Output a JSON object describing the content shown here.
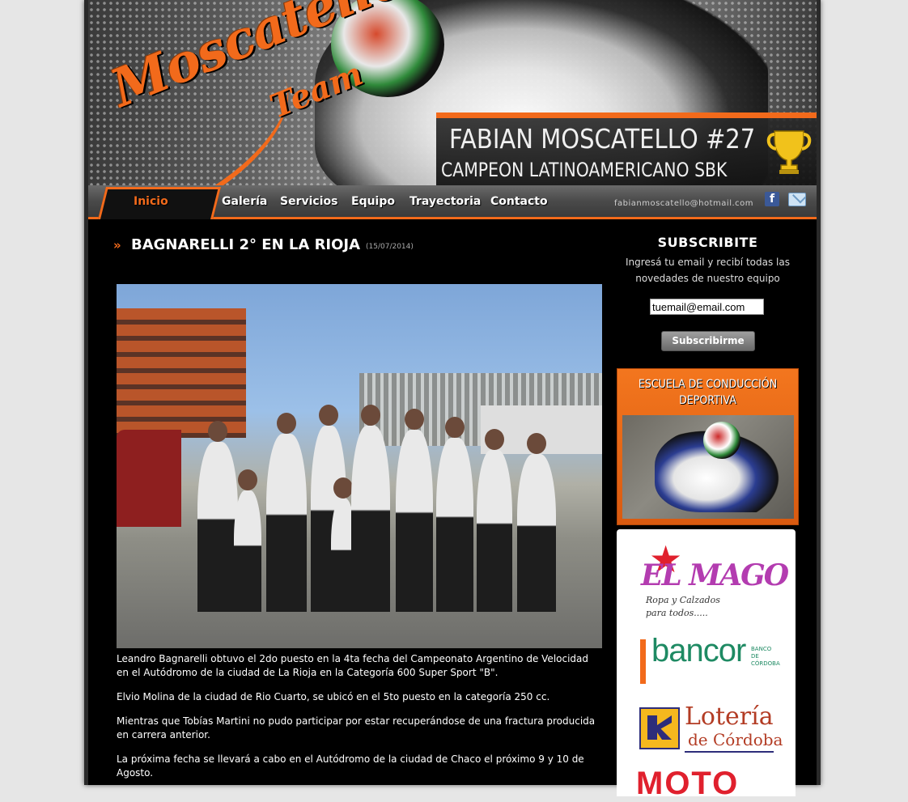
{
  "header": {
    "logo_main": "Moscatello",
    "logo_sub": "Team",
    "champion_name": "FABIAN MOSCATELLO #27",
    "champion_title": "CAMPEON LATINOAMERICANO SBK",
    "trophy_icon": "trophy-icon"
  },
  "nav": {
    "items": [
      {
        "label": "Inicio",
        "active": true
      },
      {
        "label": "Galería"
      },
      {
        "label": "Servicios"
      },
      {
        "label": "Equipo"
      },
      {
        "label": "Trayectoria"
      },
      {
        "label": "Contacto"
      }
    ],
    "email": "fabianmoscatello@hotmail.com",
    "icons": [
      "facebook-icon",
      "mail-icon"
    ]
  },
  "post": {
    "title": "BAGNARELLI 2° EN LA RIOJA",
    "date": "(15/07/2014)",
    "paragraphs": [
      "Leandro Bagnarelli obtuvo el 2do puesto en la 4ta fecha del Campeonato Argentino de Velocidad en el Autódromo de la ciudad de La Rioja en la Categoría 600 Super Sport \"B\".",
      "Elvio Molina de la ciudad de Rio Cuarto, se ubicó en el 5to puesto en la categoría 250 cc.",
      "Mientras que Tobías Martini no pudo participar por estar recuperándose de una fractura producida en carrera anterior.",
      "La próxima fecha se llevará a cabo en el Autódromo de la ciudad de Chaco el próximo 9 y 10 de Agosto."
    ]
  },
  "subscribe": {
    "title": "SUBSCRIBITE",
    "text": "Ingresá tu email y recibí todas las novedades de nuestro equipo",
    "input_value": "tuemail@email.com",
    "button_label": "Subscribirme"
  },
  "escuela": {
    "title_line1": "ESCUELA DE CONDUCCIÓN",
    "title_line2": "DEPORTIVA"
  },
  "sponsors": {
    "mago_title": "EL MAGO",
    "mago_sub1": "Ropa y Calzados",
    "mago_sub2": "para todos.....",
    "bancor": "bancor",
    "bancor_sub1": "BANCO",
    "bancor_sub2": "DE",
    "bancor_sub3": "CÓRDOBA",
    "loteria_line1": "Lotería",
    "loteria_line2": "de Córdoba",
    "moto": "MOTO"
  },
  "colors": {
    "accent": "#f26a1b",
    "background": "#000000",
    "page_bg": "#e6e6e6"
  }
}
